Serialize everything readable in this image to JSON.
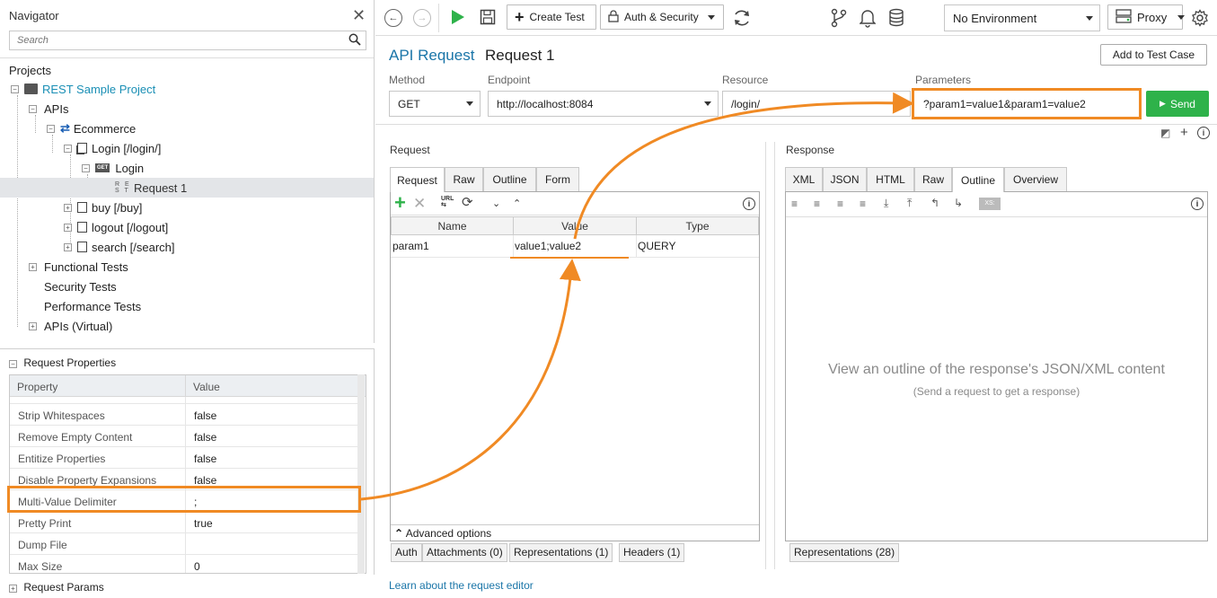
{
  "navigator": {
    "title": "Navigator",
    "search_placeholder": "Search",
    "projects_label": "Projects",
    "tree": [
      {
        "label": "REST Sample Project",
        "kind": "project"
      },
      {
        "label": "APIs",
        "kind": "folder"
      },
      {
        "label": "Ecommerce",
        "kind": "service"
      },
      {
        "label": "Login [/login/]",
        "kind": "resource"
      },
      {
        "label": "Login",
        "kind": "method",
        "badge": "GET"
      },
      {
        "label": "Request 1",
        "kind": "request",
        "badge": "REST",
        "selected": true
      },
      {
        "label": "buy [/buy]",
        "kind": "resource"
      },
      {
        "label": "logout [/logout]",
        "kind": "resource"
      },
      {
        "label": "search [/search]",
        "kind": "resource"
      },
      {
        "label": "Functional Tests",
        "kind": "folder"
      },
      {
        "label": "Security Tests",
        "kind": "folder"
      },
      {
        "label": "Performance Tests",
        "kind": "folder"
      },
      {
        "label": "APIs (Virtual)",
        "kind": "folder"
      }
    ]
  },
  "request_properties": {
    "title": "Request Properties",
    "col_property": "Property",
    "col_value": "Value",
    "rows": [
      {
        "name": "Strip Whitespaces",
        "value": "false"
      },
      {
        "name": "Remove Empty Content",
        "value": "false"
      },
      {
        "name": "Entitize Properties",
        "value": "false"
      },
      {
        "name": "Disable Property Expansions",
        "value": "false"
      },
      {
        "name": "Multi-Value Delimiter",
        "value": ";"
      },
      {
        "name": "Pretty Print",
        "value": "true"
      },
      {
        "name": "Dump File",
        "value": ""
      },
      {
        "name": "Max Size",
        "value": "0"
      }
    ],
    "footer": "Request Params"
  },
  "toolbar": {
    "create_test": "Create Test",
    "auth_security": "Auth & Security",
    "environment": "No Environment",
    "proxy": "Proxy"
  },
  "editor": {
    "type_label": "API Request",
    "name": "Request 1",
    "add_to_test_case": "Add to Test Case",
    "method_label": "Method",
    "method_value": "GET",
    "endpoint_label": "Endpoint",
    "endpoint_value": "http://localhost:8084",
    "resource_label": "Resource",
    "resource_value": "/login/",
    "parameters_label": "Parameters",
    "parameters_value": "?param1=value1&param1=value2",
    "send": "Send"
  },
  "request": {
    "label": "Request",
    "tabs": [
      "Request",
      "Raw",
      "Outline",
      "Form"
    ],
    "active_tab": "Request",
    "columns": [
      "Name",
      "Value",
      "Type"
    ],
    "params": [
      {
        "name": "param1",
        "value": "value1;value2",
        "type": "QUERY"
      }
    ],
    "advanced": "Advanced options",
    "bottom_tabs": [
      "Auth",
      "Attachments (0)",
      "Representations (1)",
      "Headers (1)"
    ]
  },
  "response": {
    "label": "Response",
    "tabs": [
      "XML",
      "JSON",
      "HTML",
      "Raw",
      "Outline",
      "Overview"
    ],
    "active_tab": "Outline",
    "message": "View an outline of the response's JSON/XML content",
    "hint": "(Send a request to get a response)",
    "bottom_tabs": [
      "Representations (28)"
    ]
  },
  "footer_link": "Learn about the request editor",
  "colors": {
    "accent": "#1a75a8",
    "highlight": "#f08a24",
    "send": "#2eb24a"
  }
}
